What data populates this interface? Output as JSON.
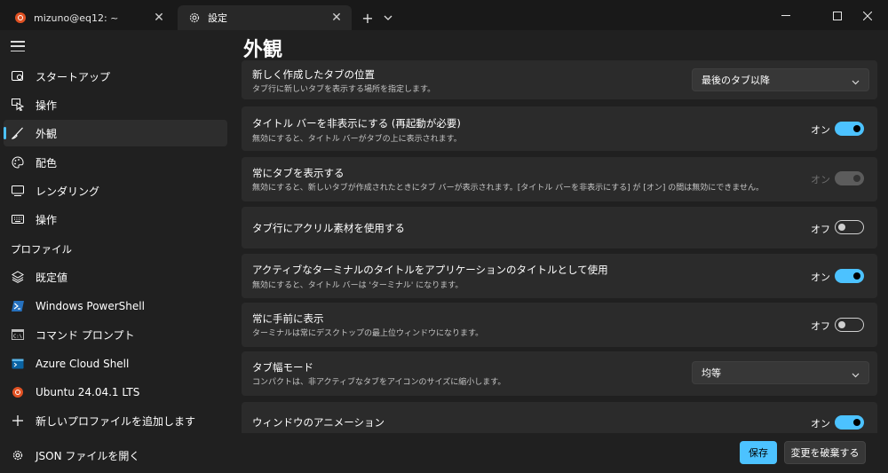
{
  "tabs": [
    {
      "title": "mizuno@eq12: ~",
      "icon": "ubuntu-icon"
    },
    {
      "title": "設定",
      "icon": "gear-icon"
    }
  ],
  "sidebar": {
    "items": [
      {
        "label": "スタートアップ",
        "icon": "startup-icon"
      },
      {
        "label": "操作",
        "icon": "interaction-icon"
      },
      {
        "label": "外観",
        "icon": "brush-icon",
        "selected": true
      },
      {
        "label": "配色",
        "icon": "palette-icon"
      },
      {
        "label": "レンダリング",
        "icon": "monitor-icon"
      },
      {
        "label": "操作",
        "icon": "keyboard-icon"
      }
    ],
    "profiles_header": "プロファイル",
    "profiles": [
      {
        "label": "既定値",
        "icon": "layers-icon"
      },
      {
        "label": "Windows PowerShell",
        "icon": "powershell-icon"
      },
      {
        "label": "コマンド プロンプト",
        "icon": "cmd-icon"
      },
      {
        "label": "Azure Cloud Shell",
        "icon": "azure-icon"
      },
      {
        "label": "Ubuntu 24.04.1 LTS",
        "icon": "ubuntu-icon"
      },
      {
        "label": "新しいプロファイルを追加します",
        "icon": "plus-icon"
      }
    ],
    "open_json": "JSON ファイルを開く"
  },
  "main": {
    "title": "外観",
    "settings": [
      {
        "title": "新しく作成したタブの位置",
        "description": "タブ行に新しいタブを表示する場所を指定します。",
        "control": "dropdown",
        "value": "最後のタブ以降"
      },
      {
        "title": "タイトル バーを非表示にする (再起動が必要)",
        "description": "無効にすると、タイトル バーがタブの上に表示されます。",
        "control": "toggle",
        "state": "オン"
      },
      {
        "title": "常にタブを表示する",
        "description": "無効にすると、新しいタブが作成されたときにタブ バーが表示されます。[タイトル バーを非表示にする] が [オン] の間は無効にできません。",
        "control": "toggle",
        "state": "オン",
        "disabled": true
      },
      {
        "title": "タブ行にアクリル素材を使用する",
        "description": "",
        "control": "toggle",
        "state": "オフ"
      },
      {
        "title": "アクティブなターミナルのタイトルをアプリケーションのタイトルとして使用",
        "description": "無効にすると、タイトル バーは 'ターミナル' になります。",
        "control": "toggle",
        "state": "オン"
      },
      {
        "title": "常に手前に表示",
        "description": "ターミナルは常にデスクトップの最上位ウィンドウになります。",
        "control": "toggle",
        "state": "オフ"
      },
      {
        "title": "タブ幅モード",
        "description": "コンパクトは、非アクティブなタブをアイコンのサイズに縮小します。",
        "control": "dropdown",
        "value": "均等"
      },
      {
        "title": "ウィンドウのアニメーション",
        "description": "",
        "control": "toggle",
        "state": "オン"
      }
    ]
  },
  "footer": {
    "save": "保存",
    "discard": "変更を破棄する"
  },
  "colors": {
    "accent": "#4cc2ff",
    "ubuntu": "#e05123",
    "card": "#2b2b2b",
    "background": "#202020"
  }
}
